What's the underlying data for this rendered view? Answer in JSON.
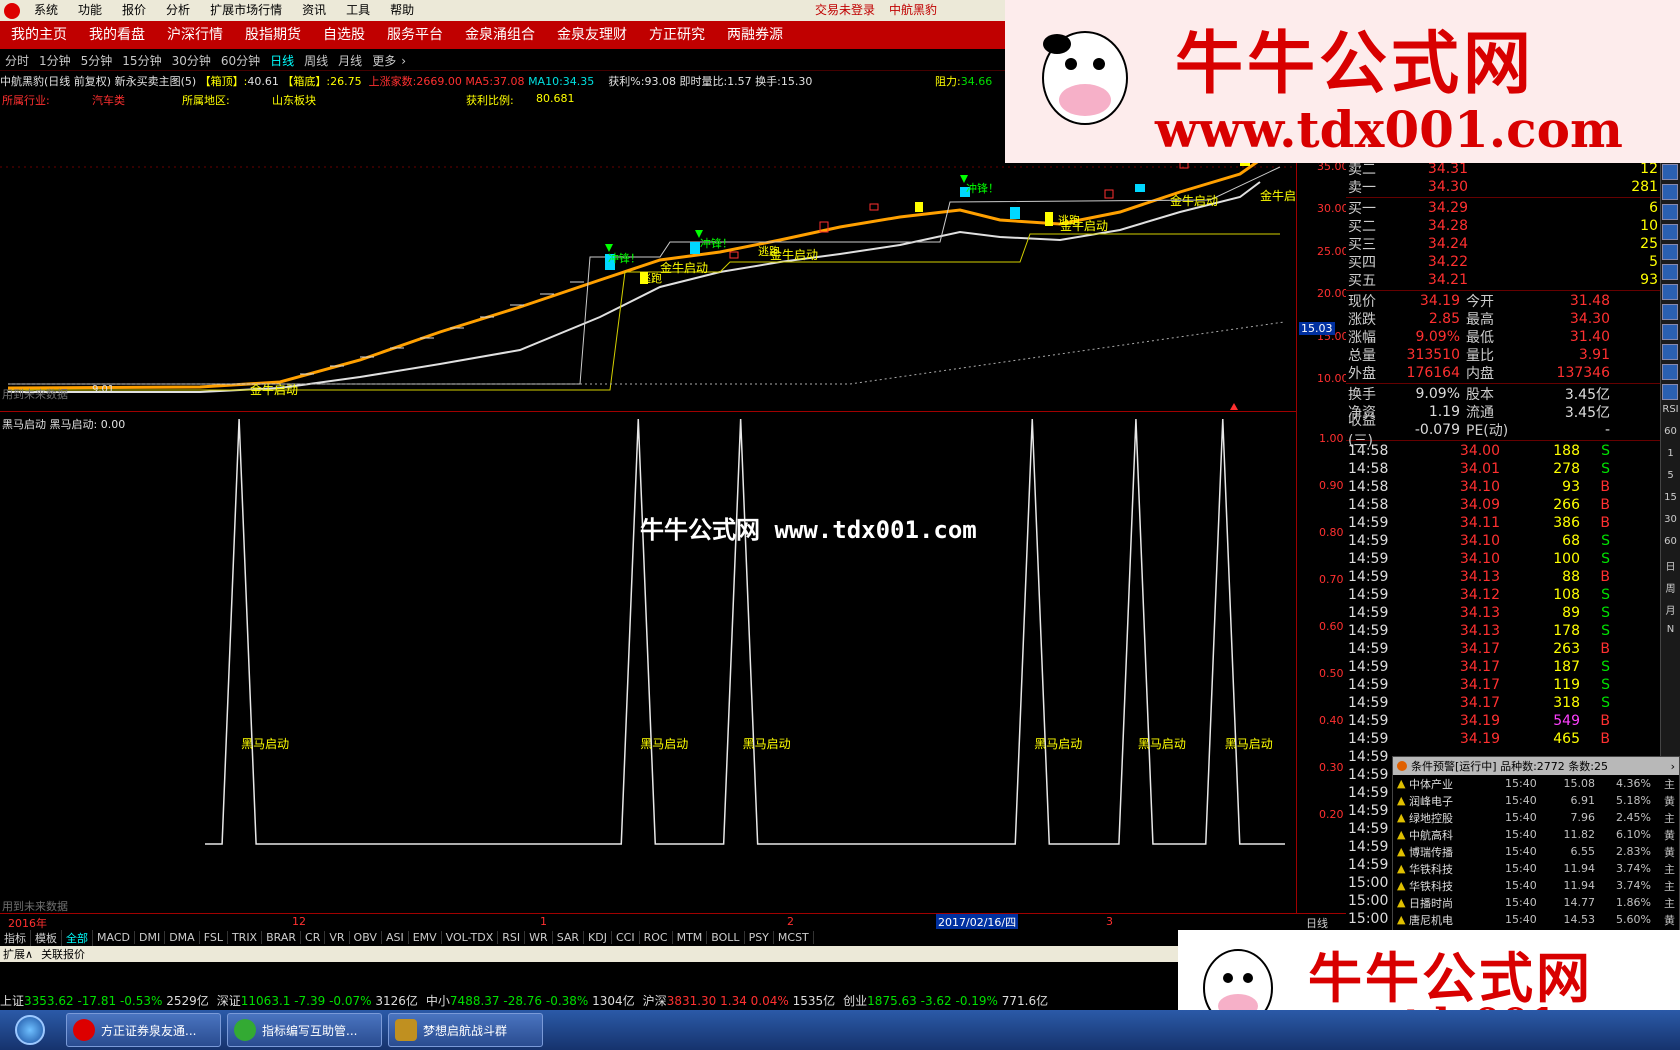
{
  "menu": {
    "items": [
      "系统",
      "功能",
      "报价",
      "分析",
      "扩展市场行情",
      "资讯",
      "工具",
      "帮助"
    ],
    "status_login": "交易未登录",
    "status_stock": "中航黑豹"
  },
  "nav": {
    "items": [
      "我的主页",
      "我的看盘",
      "沪深行情",
      "股指期货",
      "自选股",
      "服务平台",
      "金泉涌组合",
      "金泉友理财",
      "方正研究",
      "两融券源"
    ]
  },
  "periods": {
    "items": [
      "分时",
      "1分钟",
      "5分钟",
      "15分钟",
      "30分钟",
      "60分钟",
      "日线",
      "周线",
      "月线",
      "更多"
    ],
    "active": "日线"
  },
  "info": {
    "title": "中航黑豹(日线 前复权) 新永买卖主图(5)",
    "box_top_label": "【箱顶】:",
    "box_top": "40.61",
    "box_bottom_label": "【箱底】:",
    "box_bottom": "26.75",
    "rise_label": "上涨家数:",
    "rise_val": "2669.00",
    "ma5_label": "MA5:",
    "ma5": "37.08",
    "ma10_label": "MA10:",
    "ma10": "34.35",
    "profit_label": "获利%:",
    "profit": "93.08",
    "vr_label": "即时量比:",
    "vr": "1.57",
    "turn_label": "换手:",
    "turn": "15.30",
    "resist_label": "阻力:",
    "resist": "34.66",
    "industry_label": "所属行业:",
    "industry": "汽车类",
    "region_label": "所属地区:",
    "region": "山东板块",
    "profit_ratio_label": "获利比例:",
    "profit_ratio": "80.681"
  },
  "main_chart": {
    "labels": {
      "future_data": "用到未来数据",
      "price_marker": "15.03",
      "left_small": "9.01",
      "start": "金牛启动",
      "dashed_run": "冲锋！",
      "escape": "逃跑"
    },
    "y_ticks": [
      "35.00",
      "30.00",
      "25.00",
      "20.00",
      "15.00",
      "10.00"
    ]
  },
  "sub_chart": {
    "title": "黑马启动 黑马启动: 0.00",
    "peak_label": "黑马启动",
    "future_data": "用到未来数据",
    "y_ticks": [
      "1.00",
      "0.90",
      "0.80",
      "0.70",
      "0.60",
      "0.50",
      "0.40",
      "0.30",
      "0.20"
    ],
    "peaks": [
      0.176,
      0.484,
      0.563,
      0.788,
      0.868,
      0.935
    ],
    "watermark": "牛牛公式网 www.tdx001.com"
  },
  "datebar": {
    "labels": [
      "2016年",
      "12",
      "1",
      "2",
      "2017/02/16/四",
      "3"
    ],
    "period": "日线"
  },
  "indicator_tabs": {
    "items": [
      "指标",
      "模板",
      "全部",
      "MACD",
      "DMI",
      "DMA",
      "FSL",
      "TRIX",
      "BRAR",
      "CR",
      "VR",
      "OBV",
      "ASI",
      "EMV",
      "VOL-TDX",
      "RSI",
      "WR",
      "SAR",
      "KDJ",
      "CCI",
      "ROC",
      "MTM",
      "BOLL",
      "PSY",
      "MCST"
    ],
    "active": "全部"
  },
  "ext": {
    "items": [
      "扩展∧",
      "关联报价"
    ]
  },
  "quotes": {
    "sell": [
      {
        "label": "卖二",
        "price": "34.31",
        "vol": "12"
      },
      {
        "label": "卖一",
        "price": "34.30",
        "vol": "281"
      }
    ],
    "buy": [
      {
        "label": "买一",
        "price": "34.29",
        "vol": "6"
      },
      {
        "label": "买二",
        "price": "34.28",
        "vol": "10"
      },
      {
        "label": "买三",
        "price": "34.24",
        "vol": "25"
      },
      {
        "label": "买四",
        "price": "34.22",
        "vol": "5"
      },
      {
        "label": "买五",
        "price": "34.21",
        "vol": "93"
      }
    ],
    "stats": [
      {
        "l1": "现价",
        "v1": "34.19",
        "l2": "今开",
        "v2": "31.48"
      },
      {
        "l1": "涨跌",
        "v1": "2.85",
        "l2": "最高",
        "v2": "34.30"
      },
      {
        "l1": "涨幅",
        "v1": "9.09%",
        "l2": "最低",
        "v2": "31.40"
      },
      {
        "l1": "总量",
        "v1": "313510",
        "l2": "量比",
        "v2": "3.91"
      },
      {
        "l1": "外盘",
        "v1": "176164",
        "l2": "内盘",
        "v2": "137346"
      }
    ],
    "stats2": [
      {
        "l1": "换手",
        "v1": "9.09%",
        "l2": "股本",
        "v2": "3.45亿"
      },
      {
        "l1": "净资",
        "v1": "1.19",
        "l2": "流通",
        "v2": "3.45亿"
      },
      {
        "l1": "收益(三)",
        "v1": "-0.079",
        "l2": "PE(动)",
        "v2": "-"
      }
    ]
  },
  "ticks": [
    {
      "t": "14:58",
      "p": "34.00",
      "v": "188",
      "d": "S"
    },
    {
      "t": "14:58",
      "p": "34.01",
      "v": "278",
      "d": "S"
    },
    {
      "t": "14:58",
      "p": "34.10",
      "v": "93",
      "d": "B"
    },
    {
      "t": "14:58",
      "p": "34.09",
      "v": "266",
      "d": "B"
    },
    {
      "t": "14:59",
      "p": "34.11",
      "v": "386",
      "d": "B"
    },
    {
      "t": "14:59",
      "p": "34.10",
      "v": "68",
      "d": "S"
    },
    {
      "t": "14:59",
      "p": "34.10",
      "v": "100",
      "d": "S"
    },
    {
      "t": "14:59",
      "p": "34.13",
      "v": "88",
      "d": "B"
    },
    {
      "t": "14:59",
      "p": "34.12",
      "v": "108",
      "d": "S"
    },
    {
      "t": "14:59",
      "p": "34.13",
      "v": "89",
      "d": "S"
    },
    {
      "t": "14:59",
      "p": "34.13",
      "v": "178",
      "d": "S"
    },
    {
      "t": "14:59",
      "p": "34.17",
      "v": "263",
      "d": "B"
    },
    {
      "t": "14:59",
      "p": "34.17",
      "v": "187",
      "d": "S"
    },
    {
      "t": "14:59",
      "p": "34.17",
      "v": "119",
      "d": "S"
    },
    {
      "t": "14:59",
      "p": "34.17",
      "v": "318",
      "d": "S"
    },
    {
      "t": "14:59",
      "p": "34.19",
      "v": "549",
      "d": "B"
    },
    {
      "t": "14:59",
      "p": "34.19",
      "v": "465",
      "d": "B"
    }
  ],
  "tick_times_extra": [
    "14:59",
    "14:59",
    "14:59",
    "14:59",
    "14:59",
    "14:59",
    "14:59",
    "15:00",
    "15:00",
    "15:00"
  ],
  "alert": {
    "header": "条件预警[运行中] 品种数:2772 条数:25",
    "rows": [
      {
        "n": "中体产业",
        "t": "15:40",
        "p": "15.08",
        "c": "4.36%",
        "x": "主"
      },
      {
        "n": "润峰电子",
        "t": "15:40",
        "p": "6.91",
        "c": "5.18%",
        "x": "黄"
      },
      {
        "n": "绿地控股",
        "t": "15:40",
        "p": "7.96",
        "c": "2.45%",
        "x": "主"
      },
      {
        "n": "中航高科",
        "t": "15:40",
        "p": "11.82",
        "c": "6.10%",
        "x": "黄"
      },
      {
        "n": "博瑞传播",
        "t": "15:40",
        "p": "6.55",
        "c": "2.83%",
        "x": "黄"
      },
      {
        "n": "华铁科技",
        "t": "15:40",
        "p": "11.94",
        "c": "3.74%",
        "x": "主"
      },
      {
        "n": "华铁科技",
        "t": "15:40",
        "p": "11.94",
        "c": "3.74%",
        "x": "主"
      },
      {
        "n": "日播时尚",
        "t": "15:40",
        "p": "14.77",
        "c": "1.86%",
        "x": "主"
      },
      {
        "n": "唐尼机电",
        "t": "15:40",
        "p": "14.53",
        "c": "5.60%",
        "x": "黄"
      }
    ]
  },
  "indexbar": [
    {
      "name": "上证",
      "val": "3353.62",
      "chg": "-17.81",
      "pct": "-0.53%",
      "amt": "2529亿"
    },
    {
      "name": "深证",
      "val": "11063.1",
      "chg": "-7.39",
      "pct": "-0.07%",
      "amt": "3126亿"
    },
    {
      "name": "中小",
      "val": "7488.37",
      "chg": "-28.76",
      "pct": "-0.38%",
      "amt": "1304亿"
    },
    {
      "name": "沪深",
      "val": "3831.30",
      "chg": "1.34",
      "pct": "0.04%",
      "amt": "1535亿"
    },
    {
      "name": "创业",
      "val": "1875.63",
      "chg": "-3.62",
      "pct": "-0.19%",
      "amt": "771.6亿"
    }
  ],
  "taskbar": {
    "items": [
      "方正证券泉友通...",
      "指标编写互助管...",
      "梦想启航战斗群"
    ]
  },
  "ads": {
    "brand": "牛牛公式网",
    "url": "www.tdx001.com"
  },
  "toolstrip": {
    "items": [
      "RSI",
      "60",
      "1",
      "5",
      "15",
      "30",
      "60",
      "日",
      "周",
      "月",
      "N"
    ]
  },
  "colors": {
    "up": "#ff3030",
    "down": "#00e0e0",
    "accent": "#c00000"
  }
}
